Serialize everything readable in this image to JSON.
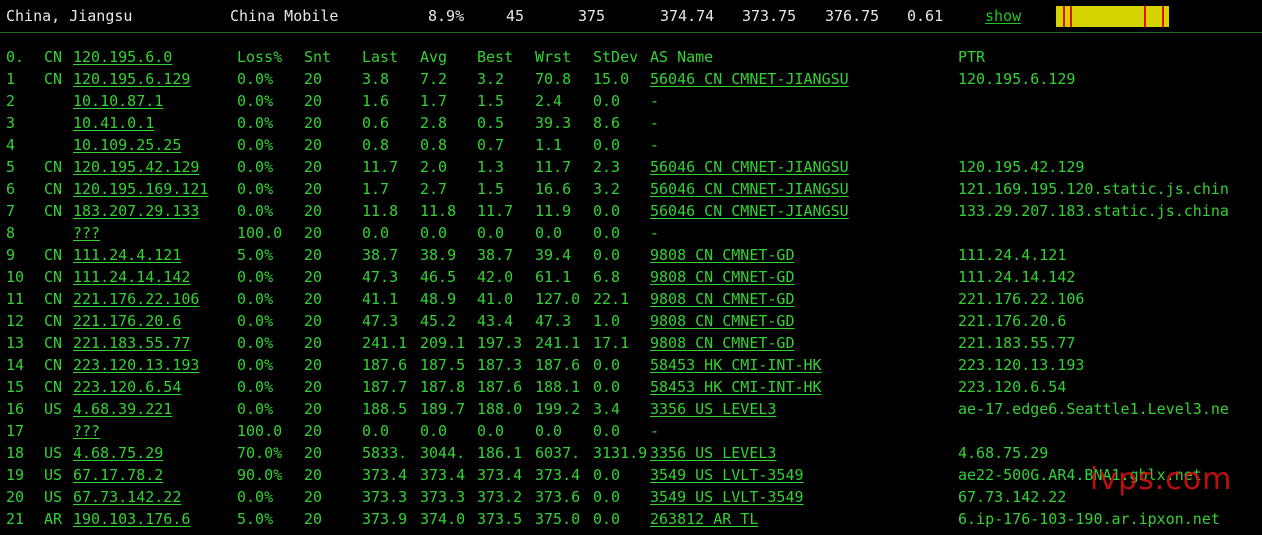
{
  "header": {
    "location": "China, Jiangsu",
    "isp": "China Mobile",
    "loss": "8.9%",
    "sent": "45",
    "last": "375",
    "avg": "374.74",
    "best": "373.75",
    "worst": "376.75",
    "stdev": "0.61",
    "show_label": "show"
  },
  "columns": {
    "no": "0.",
    "cc": "CN",
    "host": "120.195.6.0",
    "loss": "Loss%",
    "snt": "Snt",
    "last": "Last",
    "avg": "Avg",
    "best": "Best",
    "wrst": "Wrst",
    "stdev": "StDev",
    "asname": "AS Name",
    "ptr": "PTR"
  },
  "rows": [
    {
      "no": "1",
      "cc": "CN",
      "host": "120.195.6.129",
      "loss": "0.0%",
      "snt": "20",
      "last": "3.8",
      "avg": "7.2",
      "best": "3.2",
      "wrst": "70.8",
      "stdev": "15.0",
      "asname": "56046  CN CMNET-JIANGSU",
      "ptr": "120.195.6.129"
    },
    {
      "no": "2",
      "cc": "",
      "host": "10.10.87.1",
      "loss": "0.0%",
      "snt": "20",
      "last": "1.6",
      "avg": "1.7",
      "best": "1.5",
      "wrst": "2.4",
      "stdev": "0.0",
      "asname": "-",
      "ptr": ""
    },
    {
      "no": "3",
      "cc": "",
      "host": "10.41.0.1",
      "loss": "0.0%",
      "snt": "20",
      "last": "0.6",
      "avg": "2.8",
      "best": "0.5",
      "wrst": "39.3",
      "stdev": "8.6",
      "asname": "-",
      "ptr": ""
    },
    {
      "no": "4",
      "cc": "",
      "host": "10.109.25.25",
      "loss": "0.0%",
      "snt": "20",
      "last": "0.8",
      "avg": "0.8",
      "best": "0.7",
      "wrst": "1.1",
      "stdev": "0.0",
      "asname": "-",
      "ptr": ""
    },
    {
      "no": "5",
      "cc": "CN",
      "host": "120.195.42.129",
      "loss": "0.0%",
      "snt": "20",
      "last": "11.7",
      "avg": "2.0",
      "best": "1.3",
      "wrst": "11.7",
      "stdev": "2.3",
      "asname": "56046  CN CMNET-JIANGSU",
      "ptr": "120.195.42.129"
    },
    {
      "no": "6",
      "cc": "CN",
      "host": "120.195.169.121",
      "loss": "0.0%",
      "snt": "20",
      "last": "1.7",
      "avg": "2.7",
      "best": "1.5",
      "wrst": "16.6",
      "stdev": "3.2",
      "asname": "56046  CN CMNET-JIANGSU",
      "ptr": "121.169.195.120.static.js.chin"
    },
    {
      "no": "7",
      "cc": "CN",
      "host": "183.207.29.133",
      "loss": "0.0%",
      "snt": "20",
      "last": "11.8",
      "avg": "11.8",
      "best": "11.7",
      "wrst": "11.9",
      "stdev": "0.0",
      "asname": "56046  CN CMNET-JIANGSU",
      "ptr": "133.29.207.183.static.js.china"
    },
    {
      "no": "8",
      "cc": "",
      "host": "???",
      "loss": "100.0",
      "snt": "20",
      "last": "0.0",
      "avg": "0.0",
      "best": "0.0",
      "wrst": "0.0",
      "stdev": "0.0",
      "asname": "-",
      "ptr": ""
    },
    {
      "no": "9",
      "cc": "CN",
      "host": "111.24.4.121",
      "loss": "5.0%",
      "snt": "20",
      "last": "38.7",
      "avg": "38.9",
      "best": "38.7",
      "wrst": "39.4",
      "stdev": "0.0",
      "asname": "9808   CN CMNET-GD",
      "ptr": "111.24.4.121"
    },
    {
      "no": "10",
      "cc": "CN",
      "host": "111.24.14.142",
      "loss": "0.0%",
      "snt": "20",
      "last": "47.3",
      "avg": "46.5",
      "best": "42.0",
      "wrst": "61.1",
      "stdev": "6.8",
      "asname": "9808   CN CMNET-GD",
      "ptr": "111.24.14.142"
    },
    {
      "no": "11",
      "cc": "CN",
      "host": "221.176.22.106",
      "loss": "0.0%",
      "snt": "20",
      "last": "41.1",
      "avg": "48.9",
      "best": "41.0",
      "wrst": "127.0",
      "stdev": "22.1",
      "asname": "9808   CN CMNET-GD",
      "ptr": "221.176.22.106"
    },
    {
      "no": "12",
      "cc": "CN",
      "host": "221.176.20.6",
      "loss": "0.0%",
      "snt": "20",
      "last": "47.3",
      "avg": "45.2",
      "best": "43.4",
      "wrst": "47.3",
      "stdev": "1.0",
      "asname": "9808   CN CMNET-GD",
      "ptr": "221.176.20.6"
    },
    {
      "no": "13",
      "cc": "CN",
      "host": "221.183.55.77",
      "loss": "0.0%",
      "snt": "20",
      "last": "241.1",
      "avg": "209.1",
      "best": "197.3",
      "wrst": "241.1",
      "stdev": "17.1",
      "asname": "9808   CN CMNET-GD",
      "ptr": "221.183.55.77"
    },
    {
      "no": "14",
      "cc": "CN",
      "host": "223.120.13.193",
      "loss": "0.0%",
      "snt": "20",
      "last": "187.6",
      "avg": "187.5",
      "best": "187.3",
      "wrst": "187.6",
      "stdev": "0.0",
      "asname": "58453  HK CMI-INT-HK",
      "ptr": "223.120.13.193"
    },
    {
      "no": "15",
      "cc": "CN",
      "host": "223.120.6.54",
      "loss": "0.0%",
      "snt": "20",
      "last": "187.7",
      "avg": "187.8",
      "best": "187.6",
      "wrst": "188.1",
      "stdev": "0.0",
      "asname": "58453  HK CMI-INT-HK",
      "ptr": "223.120.6.54"
    },
    {
      "no": "16",
      "cc": "US",
      "host": "4.68.39.221",
      "loss": "0.0%",
      "snt": "20",
      "last": "188.5",
      "avg": "189.7",
      "best": "188.0",
      "wrst": "199.2",
      "stdev": "3.4",
      "asname": "3356   US LEVEL3",
      "ptr": "ae-17.edge6.Seattle1.Level3.ne"
    },
    {
      "no": "17",
      "cc": "",
      "host": "???",
      "loss": "100.0",
      "snt": "20",
      "last": "0.0",
      "avg": "0.0",
      "best": "0.0",
      "wrst": "0.0",
      "stdev": "0.0",
      "asname": "-",
      "ptr": ""
    },
    {
      "no": "18",
      "cc": "US",
      "host": "4.68.75.29",
      "loss": "70.0%",
      "snt": "20",
      "last": "5833.",
      "avg": "3044.",
      "best": "186.1",
      "wrst": "6037.",
      "stdev": "3131.9",
      "asname": "3356   US LEVEL3",
      "ptr": "4.68.75.29"
    },
    {
      "no": "19",
      "cc": "US",
      "host": "67.17.78.2",
      "loss": "90.0%",
      "snt": "20",
      "last": "373.4",
      "avg": "373.4",
      "best": "373.4",
      "wrst": "373.4",
      "stdev": "0.0",
      "asname": "3549   US LVLT-3549",
      "ptr": "ae22-500G.AR4.BNA1.gblx.net"
    },
    {
      "no": "20",
      "cc": "US",
      "host": "67.73.142.22",
      "loss": "0.0%",
      "snt": "20",
      "last": "373.3",
      "avg": "373.3",
      "best": "373.2",
      "wrst": "373.6",
      "stdev": "0.0",
      "asname": "3549   US LVLT-3549",
      "ptr": "67.73.142.22"
    },
    {
      "no": "21",
      "cc": "AR",
      "host": "190.103.176.6",
      "loss": "5.0%",
      "snt": "20",
      "last": "373.9",
      "avg": "374.0",
      "best": "373.5",
      "wrst": "375.0",
      "stdev": "0.0",
      "asname": "263812 AR TL",
      "ptr": "6.ip-176-103-190.ar.ipxon.net"
    }
  ],
  "watermark": "ivps.com",
  "loss_bar": {
    "fill_color": "#d6d400",
    "tick_color": "#e01010",
    "tick_count": 4
  },
  "colors": {
    "text": "#34d134",
    "header_text": "#e8e8e8",
    "background": "#000000"
  }
}
